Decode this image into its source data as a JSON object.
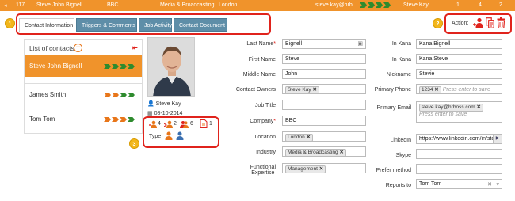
{
  "topbar": {
    "id": "117",
    "name": "Steve John Bignell",
    "company": "BBC",
    "industry": "Media & Broadcasting",
    "location": "London",
    "email": "steve.kay@hrb...",
    "owner": "Steve Kay",
    "col1": "1",
    "col2": "4",
    "col3": "2"
  },
  "badges": {
    "tabs": "1",
    "actions": "2",
    "stats": "3"
  },
  "tabs": [
    {
      "label": "Contact Information",
      "active": true
    },
    {
      "label": "Triggers & Comments",
      "active": false
    },
    {
      "label": "Job Activity",
      "active": false
    },
    {
      "label": "Contact Document",
      "active": false
    }
  ],
  "actions": {
    "label": "Action:"
  },
  "contacts": {
    "title": "List of contacts",
    "items": [
      {
        "name": "Steve John Bignell",
        "selected": true
      },
      {
        "name": "James Smith",
        "selected": false
      },
      {
        "name": "Tom Tom",
        "selected": false
      }
    ]
  },
  "profile": {
    "owner": "Steve Kay",
    "date": "08-10-2014",
    "stats": [
      "4",
      "2",
      "6",
      "1"
    ],
    "type_label": "Type"
  },
  "form": {
    "last_name_label": "Last Name",
    "last_name": "Bignell",
    "first_name_label": "First Name",
    "first_name": "Steve",
    "middle_name_label": "Middle Name",
    "middle_name": "John",
    "owners_label": "Contact Owners",
    "owners_chip": "Steve Kay",
    "job_title_label": "Job Title",
    "job_title": "",
    "company_label": "Company",
    "company": "BBC",
    "location_label": "Location",
    "location_chip": "London",
    "industry_label": "Industry",
    "industry_chip": "Media & Broadcasting",
    "func_label_1": "Functional",
    "func_label_2": "Expertise",
    "func_chip": "Management",
    "in_kana_label_1": "In Kana",
    "in_kana_1": "Kana Bignell",
    "in_kana_label_2": "In Kana",
    "in_kana_2": "Kana Steve",
    "nickname_label": "Nickname",
    "nickname": "Stevie",
    "phone_label": "Primary Phone",
    "phone_chip": "1234",
    "phone_placeholder": "Press enter to save",
    "email_label": "Primary Email",
    "email_chip": "steve.kay@hrboss.com",
    "email_placeholder": "Press enter to save",
    "linkedin_label": "LinkedIn",
    "linkedin": "https://www.linkedin.com/in/ste",
    "skype_label": "Skype",
    "skype": "",
    "prefer_label": "Prefer method",
    "prefer": "",
    "reports_label": "Reports to",
    "reports": "Tom Tom"
  },
  "colors": {
    "orange": "#f0932b",
    "red": "#e0231c",
    "tab_blue": "#5e8ea8",
    "green": "#2e8b2e",
    "badge": "#f2b61a"
  }
}
